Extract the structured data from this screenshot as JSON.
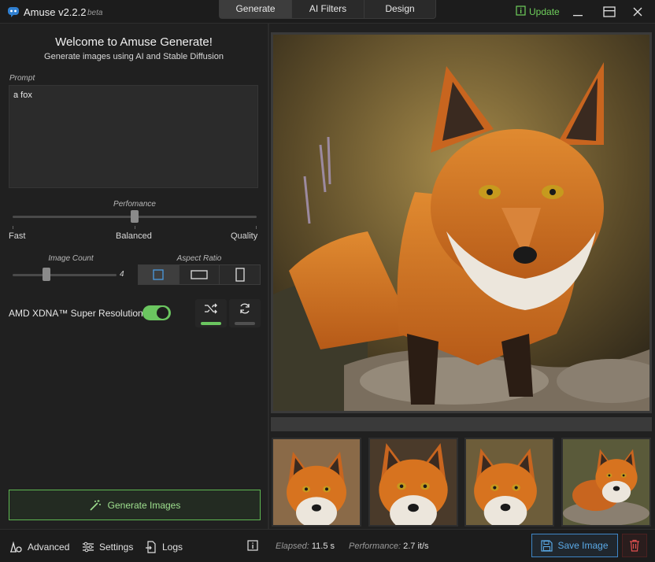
{
  "app": {
    "title": "Amuse v2.2.2",
    "beta": "beta",
    "update_label": "Update"
  },
  "tabs": [
    {
      "label": "Generate"
    },
    {
      "label": "AI Filters"
    },
    {
      "label": "Design"
    }
  ],
  "left": {
    "welcome": "Welcome to Amuse Generate!",
    "subtitle": "Generate images using AI and Stable Diffusion",
    "prompt_label": "Prompt",
    "prompt_value": "a fox",
    "performance": {
      "label": "Perfomance",
      "fast": "Fast",
      "balanced": "Balanced",
      "quality": "Quality",
      "level": 0.5
    },
    "image_count": {
      "label": "Image Count",
      "value": "4"
    },
    "aspect_ratio": {
      "label": "Aspect Ratio",
      "options": [
        "square",
        "landscape",
        "portrait"
      ],
      "selected": "square"
    },
    "super_resolution": {
      "label": "AMD XDNA™ Super Resolution",
      "enabled": true
    },
    "generate_label": "Generate Images"
  },
  "status": {
    "advanced": "Advanced",
    "settings": "Settings",
    "logs": "Logs",
    "elapsed_label": "Elapsed:",
    "elapsed_value": "11.5 s",
    "performance_label": "Performance:",
    "performance_value": "2.7 it/s",
    "save_label": "Save Image"
  },
  "colors": {
    "accent_green": "#6bc660",
    "accent_blue": "#3f86c7",
    "danger_red": "#e05050"
  }
}
